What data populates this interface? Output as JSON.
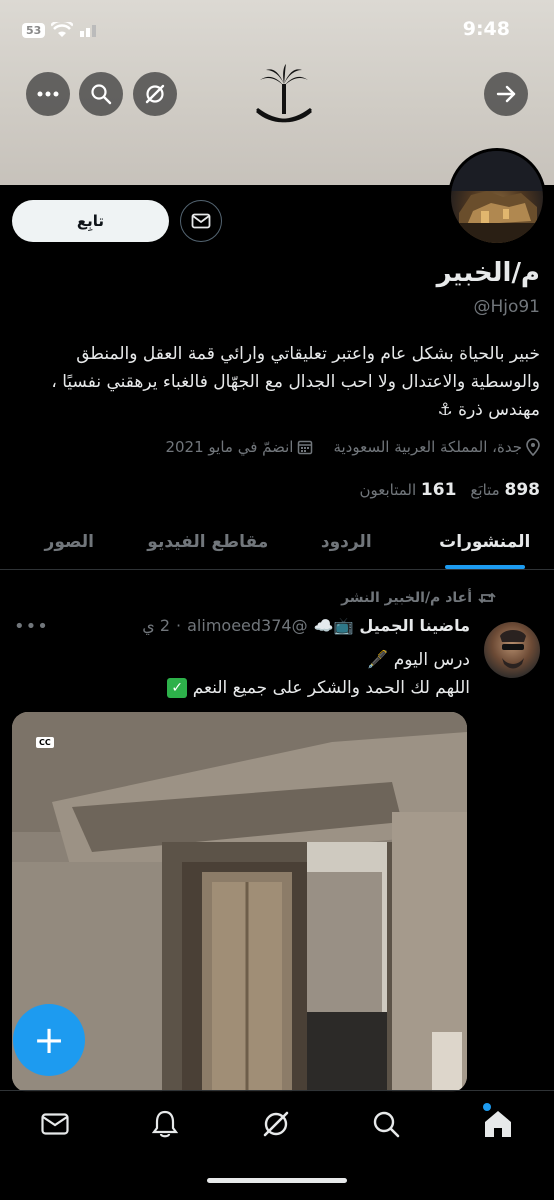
{
  "status_bar": {
    "time": "9:48",
    "battery": "53"
  },
  "profile": {
    "name": "م/الخبير",
    "handle": "@Hjo91",
    "bio": "خبير بالحياة بشكل عام واعتبر تعليقاتي وارائي قمة العقل والمنطق والوسطية والاعتدال ولا احب الجدال مع الجهّال فالغباء يرهقني نفسيًا ، مهندس ذرة ⚓",
    "location": "جدة، المملكة العربية السعودية",
    "joined": "انضمّ في مايو 2021",
    "following_count": "898",
    "following_label": "متابَع",
    "followers_count": "161",
    "followers_label": "المتابعون",
    "follow_button": "تابِع"
  },
  "tabs": [
    "المنشورات",
    "الردود",
    "مقاطع الفيديو",
    "الصور"
  ],
  "post": {
    "repost_label": "أعاد م/الخبير النشر",
    "author": "ماضينا الجميل",
    "author_emojis": "📺☁️",
    "handle": "@alimoeed374",
    "time": "2 ي",
    "line1": "درس اليوم 🖋️",
    "line2": "اللهم لك الحمد والشكر على جميع النعم",
    "media_badge": "CC"
  },
  "fab_label": "+",
  "colors": {
    "accent": "#1d9bf0",
    "background": "#000000",
    "secondary_text": "#71767b"
  }
}
